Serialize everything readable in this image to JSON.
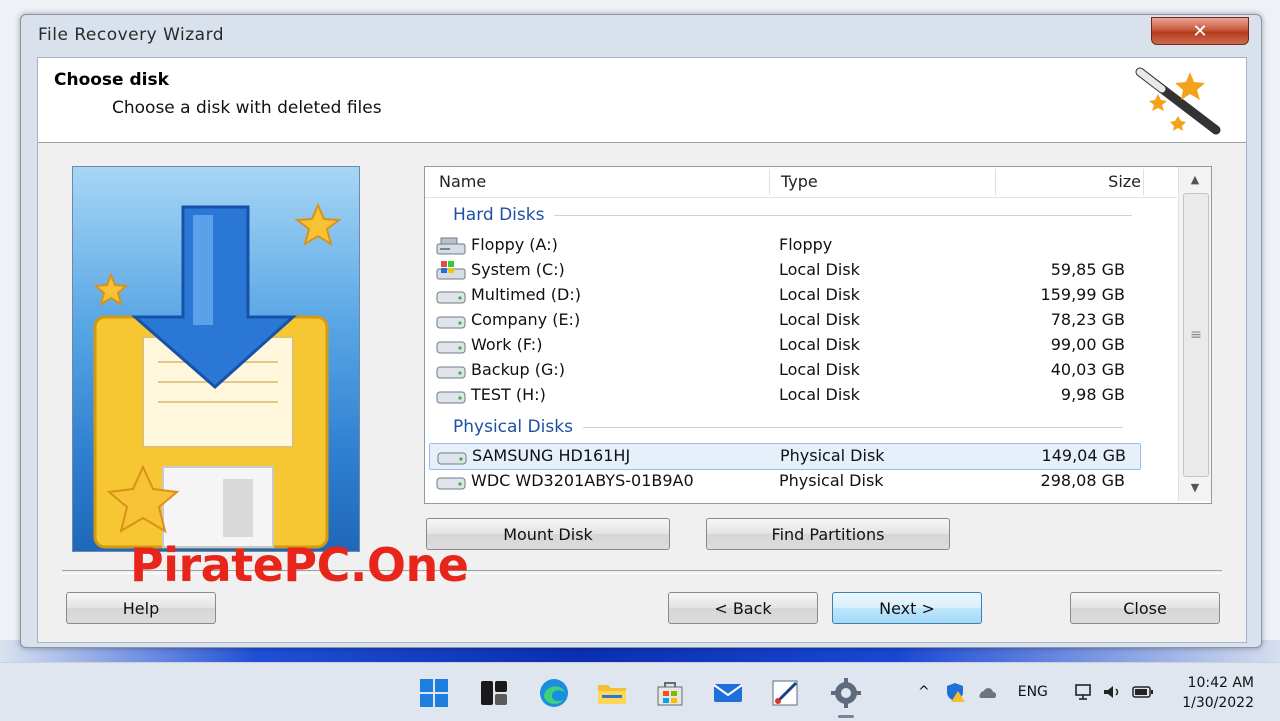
{
  "window": {
    "title": "File Recovery Wizard",
    "close_glyph": "✕"
  },
  "header": {
    "title": "Choose disk",
    "subtitle": "Choose a disk with deleted files",
    "icon": "magic-wand-icon"
  },
  "disk_list": {
    "columns": {
      "name": "Name",
      "type": "Type",
      "size": "Size"
    },
    "groups": [
      {
        "label": "Hard Disks",
        "items": [
          {
            "name": "Floppy (A:)",
            "type": "Floppy",
            "size": "",
            "icon": "floppy-drive-icon"
          },
          {
            "name": "System (C:)",
            "type": "Local Disk",
            "size": "59,85 GB",
            "icon": "system-drive-icon"
          },
          {
            "name": "Multimed (D:)",
            "type": "Local Disk",
            "size": "159,99 GB",
            "icon": "hard-drive-icon"
          },
          {
            "name": "Company (E:)",
            "type": "Local Disk",
            "size": "78,23 GB",
            "icon": "hard-drive-icon"
          },
          {
            "name": "Work (F:)",
            "type": "Local Disk",
            "size": "99,00 GB",
            "icon": "hard-drive-icon"
          },
          {
            "name": "Backup (G:)",
            "type": "Local Disk",
            "size": "40,03 GB",
            "icon": "hard-drive-icon"
          },
          {
            "name": "TEST (H:)",
            "type": "Local Disk",
            "size": "9,98 GB",
            "icon": "hard-drive-icon"
          }
        ]
      },
      {
        "label": "Physical Disks",
        "items": [
          {
            "name": "SAMSUNG HD161HJ",
            "type": "Physical Disk",
            "size": "149,04 GB",
            "icon": "hard-drive-icon",
            "selected": true
          },
          {
            "name": "WDC WD3201ABYS-01B9A0",
            "type": "Physical Disk",
            "size": "298,08 GB",
            "icon": "hard-drive-icon"
          }
        ]
      }
    ]
  },
  "buttons": {
    "mount_disk": "Mount Disk",
    "find_partitions": "Find Partitions",
    "help": "Help",
    "back": "< Back",
    "next": "Next >",
    "close": "Close"
  },
  "watermark": "PiratePC.One",
  "taskbar": {
    "apps": [
      "windows-start-icon",
      "task-view-icon",
      "edge-browser-icon",
      "file-explorer-icon",
      "microsoft-store-icon",
      "mail-icon",
      "paint-app-icon",
      "settings-gear-icon"
    ],
    "tray": {
      "chevron": "^",
      "language": "ENG"
    },
    "clock": {
      "time": "10:42 AM",
      "date": "1/30/2022"
    }
  },
  "colors": {
    "accent": "#1f4fa8",
    "close_button": "#c24a2c",
    "watermark": "#e8251b",
    "selected_row": "#e6f0fb"
  }
}
